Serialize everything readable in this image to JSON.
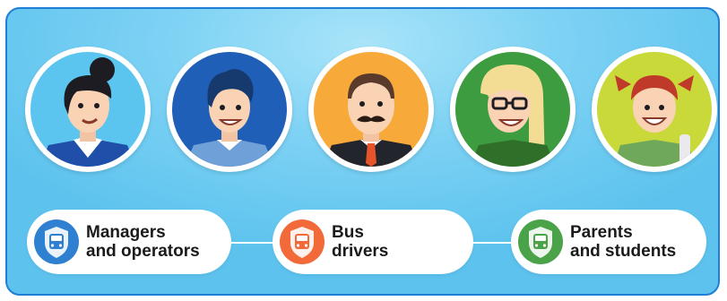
{
  "avatars": [
    {
      "icon": "female-manager-avatar",
      "bg": "#5bc4ef"
    },
    {
      "icon": "male-operator-avatar",
      "bg": "#1f5fb8"
    },
    {
      "icon": "bus-driver-avatar",
      "bg": "#f7a93a"
    },
    {
      "icon": "parent-avatar",
      "bg": "#3d9c3f"
    },
    {
      "icon": "student-avatar",
      "bg": "#c9d93a"
    }
  ],
  "roles": [
    {
      "line1": "Managers",
      "line2": "and operators",
      "color": "#2f80d0",
      "icon": "bus-shield-icon"
    },
    {
      "line1": "Bus",
      "line2": "drivers",
      "color": "#f26a3a",
      "icon": "bus-shield-icon"
    },
    {
      "line1": "Parents",
      "line2": "and students",
      "color": "#4aa349",
      "icon": "bus-shield-icon"
    }
  ]
}
